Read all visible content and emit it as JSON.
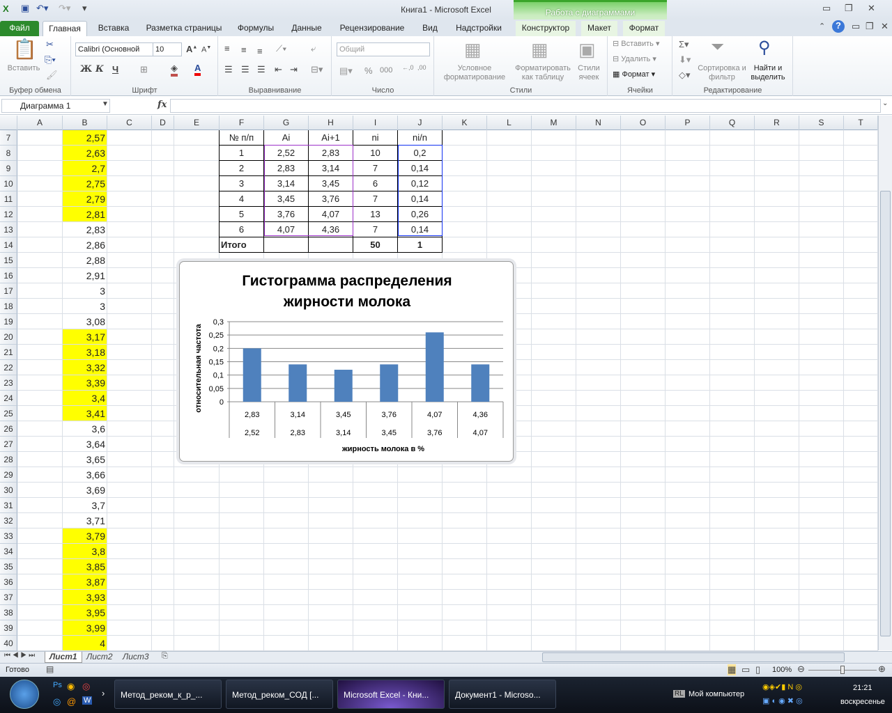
{
  "window": {
    "title": "Книга1  -  Microsoft Excel",
    "context_group": "Работа с диаграммами"
  },
  "tabs": [
    "Файл",
    "Главная",
    "Вставка",
    "Разметка страницы",
    "Формулы",
    "Данные",
    "Рецензирование",
    "Вид",
    "Надстройки",
    "Конструктор",
    "Макет",
    "Формат"
  ],
  "ribbon": {
    "clipboard": {
      "label": "Буфер обмена",
      "paste": "Вставить"
    },
    "font": {
      "label": "Шрифт",
      "name": "Calibri (Основной",
      "size": "10",
      "bold": "Ж",
      "italic": "К",
      "underline": "Ч"
    },
    "alignment": {
      "label": "Выравнивание"
    },
    "number": {
      "label": "Число",
      "format": "Общий",
      "percent": "%",
      "thousands": "000"
    },
    "styles": {
      "label": "Стили",
      "conditional": "Условное форматирование",
      "as_table": "Форматировать как таблицу",
      "cell_styles": "Стили ячеек"
    },
    "cells": {
      "label": "Ячейки",
      "insert": "Вставить",
      "delete": "Удалить",
      "format": "Формат"
    },
    "editing": {
      "label": "Редактирование",
      "sort": "Сортировка и фильтр",
      "find": "Найти и выделить"
    }
  },
  "formula_bar": {
    "name_box": "Диаграмма 1",
    "fx": "fx",
    "value": ""
  },
  "columns": [
    "A",
    "B",
    "C",
    "D",
    "E",
    "F",
    "G",
    "H",
    "I",
    "J",
    "K",
    "L",
    "M",
    "N",
    "O",
    "P",
    "Q",
    "R",
    "S",
    "T"
  ],
  "rows": {
    "start": 7,
    "b_values": [
      "2,57",
      "2,63",
      "2,7",
      "2,75",
      "2,79",
      "2,81",
      "2,83",
      "2,86",
      "2,88",
      "2,91",
      "3",
      "3",
      "3,08",
      "3,17",
      "3,18",
      "3,32",
      "3,39",
      "3,4",
      "3,41",
      "3,6",
      "3,64",
      "3,65",
      "3,66",
      "3,69",
      "3,7",
      "3,71",
      "3,79",
      "3,8",
      "3,85",
      "3,87",
      "3,93",
      "3,95",
      "3,99",
      "4"
    ],
    "b_highlight": [
      1,
      1,
      1,
      1,
      1,
      1,
      0,
      0,
      0,
      0,
      0,
      0,
      0,
      1,
      1,
      1,
      1,
      1,
      1,
      0,
      0,
      0,
      0,
      0,
      0,
      0,
      1,
      1,
      1,
      1,
      1,
      1,
      1,
      1
    ]
  },
  "table": {
    "headers": [
      "№ п/п",
      "Ai",
      "Ai+1",
      "ni",
      "ni/n"
    ],
    "rows": [
      [
        "1",
        "2,52",
        "2,83",
        "10",
        "0,2"
      ],
      [
        "2",
        "2,83",
        "3,14",
        "7",
        "0,14"
      ],
      [
        "3",
        "3,14",
        "3,45",
        "6",
        "0,12"
      ],
      [
        "4",
        "3,45",
        "3,76",
        "7",
        "0,14"
      ],
      [
        "5",
        "3,76",
        "4,07",
        "13",
        "0,26"
      ],
      [
        "6",
        "4,07",
        "4,36",
        "7",
        "0,14"
      ]
    ],
    "total": [
      "Итого",
      "",
      "",
      "50",
      "1"
    ]
  },
  "chart_data": {
    "type": "bar",
    "title": "Гистограмма распределения жирности молока",
    "title_lines": [
      "Гистограмма распределения",
      "жирности молока"
    ],
    "xlabel": "жирность молока в %",
    "ylabel": "относительная  частота",
    "categories_upper": [
      "2,83",
      "3,14",
      "3,45",
      "3,76",
      "4,07",
      "4,36"
    ],
    "categories_lower": [
      "2,52",
      "2,83",
      "3,14",
      "3,45",
      "3,76",
      "4,07"
    ],
    "values": [
      0.2,
      0.14,
      0.12,
      0.14,
      0.26,
      0.14
    ],
    "ylim": [
      0,
      0.3
    ],
    "yticks": [
      "0",
      "0,05",
      "0,1",
      "0,15",
      "0,2",
      "0,25",
      "0,3"
    ],
    "grid": true,
    "bar_color": "#4f81bd"
  },
  "sheets": [
    "Лист1",
    "Лист2",
    "Лист3"
  ],
  "status": {
    "ready": "Готово",
    "zoom": "100%"
  },
  "taskbar": {
    "items": [
      "Метод_реком_к_р_...",
      "Метод_реком_СОД [...",
      "Microsoft Excel - Кни...",
      "Документ1 - Microso..."
    ],
    "tray_label": "Мой компьютер",
    "lang": "RL",
    "time": "21:21",
    "day": "воскресенье"
  }
}
